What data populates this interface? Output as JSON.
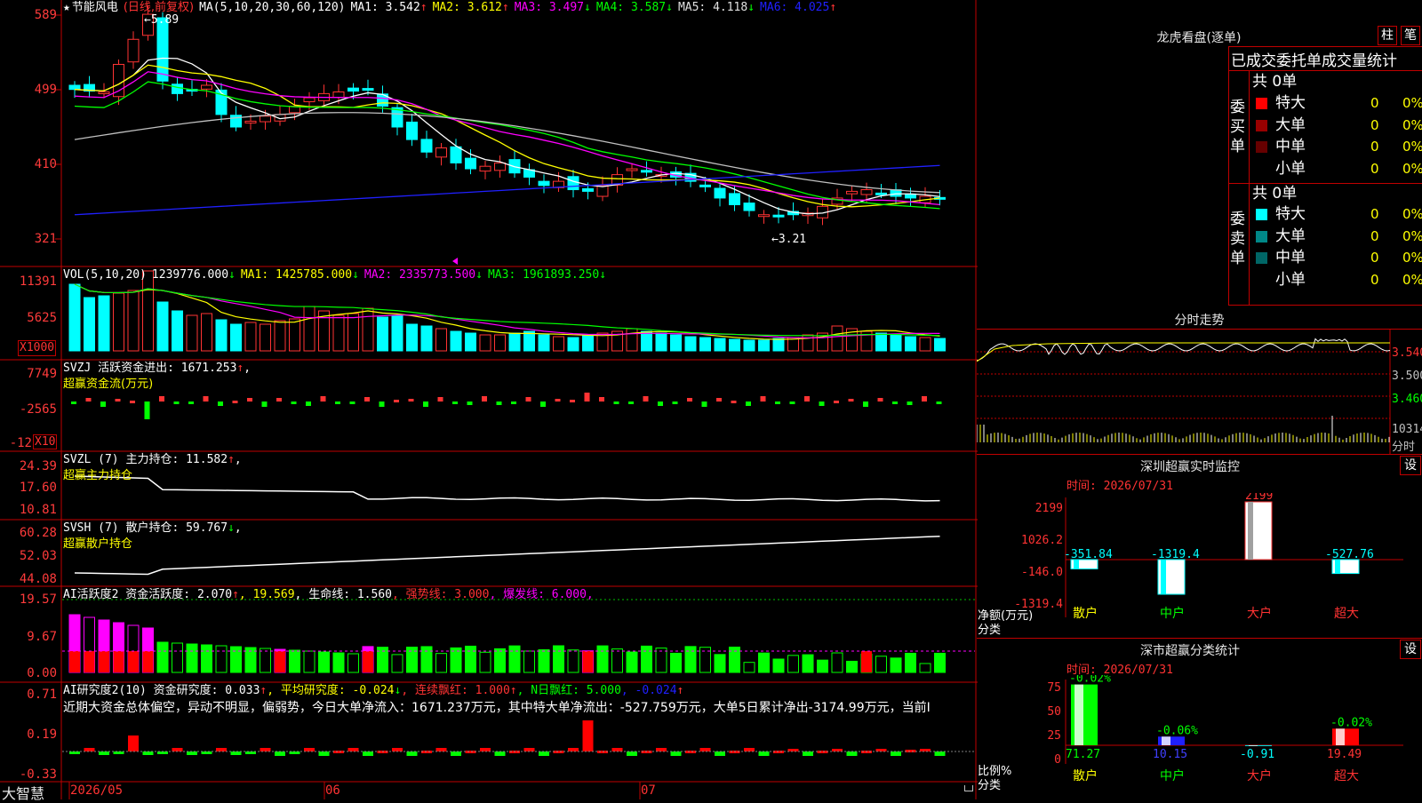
{
  "colors": {
    "up": "#ff3333",
    "down": "#00ffff",
    "grid": "#c00000",
    "bg": "#000000",
    "ma1": "#ffffff",
    "ma2": "#ffff00",
    "ma3": "#ff00ff",
    "ma4": "#00ff00",
    "ma5": "#c0c0c0",
    "ma6": "#2020ff"
  },
  "header": {
    "star": "★",
    "stock": "节能风电",
    "period": "(日线,前复权)",
    "ma_label": "MA(5,10,20,30,60,120)",
    "ma1": "MA1: 3.542",
    "ma1_arrow": "↑",
    "ma2": "MA2: 3.612",
    "ma2_arrow": "↑",
    "ma3": "MA3: 3.497",
    "ma3_arrow": "↓",
    "ma4": "MA4: 3.587",
    "ma4_arrow": "↓",
    "ma5": "MA5: 4.118",
    "ma5_arrow": "↓",
    "ma6": "MA6: 4.025",
    "ma6_arrow": "↑",
    "high_note": "5.89",
    "low_note": "←3.21"
  },
  "price_axis": [
    "589",
    "499",
    "410",
    "321"
  ],
  "vol": {
    "title": "VOL(5,10,20)",
    "v": "1239776.000",
    "v_arrow": "↓",
    "ma1": "MA1: 1425785.000",
    "ma1_arrow": "↓",
    "ma2": "MA2: 2335773.500",
    "ma2_arrow": "↓",
    "ma3": "MA3: 1961893.250",
    "ma3_arrow": "↓",
    "axis": [
      "11391",
      "5625"
    ],
    "unit": "X1000"
  },
  "svzj": {
    "title": "SVZJ  活跃资金进出: 1671.253",
    "arrow": "↑",
    "comma": ",",
    "subtitle": "超赢资金流(万元)",
    "axis": [
      "7749",
      "-2565",
      "-12"
    ],
    "unit": "X10"
  },
  "svzl": {
    "title": "SVZL (7) 主力持仓: 11.582",
    "arrow": "↑",
    "comma": ",",
    "subtitle": "超赢主力持仓",
    "axis": [
      "24.39",
      "17.60",
      "10.81"
    ]
  },
  "svsh": {
    "title": "SVSH (7) 散户持仓: 59.767",
    "arrow": "↓",
    "comma": ",",
    "subtitle": "超赢散户持仓",
    "axis": [
      "60.28",
      "52.03",
      "44.08"
    ]
  },
  "ai1": {
    "title": "AI活跃度2 资金活跃度: 2.070",
    "a1": "↑",
    "v2": ", 19.569",
    "lf": ", 生命线: 1.560",
    "strong": ", 强势线: 3.000",
    "burst": ", 爆发线: 6.000,",
    "axis": [
      "19.57",
      "9.67",
      "0.00"
    ]
  },
  "ai2": {
    "title": "AI研究度2(10) 资金研究度: 0.033",
    "a1": "↑",
    "avg": ", 平均研究度: -0.024",
    "a2": "↓",
    "streak": ", 连续飘红: 1.000",
    "a3": "↑",
    "nday": ", N日飘红: 5.000",
    "negv": ", -0.024",
    "a4": "↑",
    "summary": "近期大资金总体偏空，异动不明显，偏弱势，今日大单净流入：1671.237万元，其中特大单净流出：-527.759万元，大单5日累计净出-3174.99万元，当前I",
    "axis": [
      "0.71",
      "0.19",
      "-0.33"
    ]
  },
  "footer": {
    "brand": "大智慧",
    "dates": [
      "2026/05",
      "06",
      "07"
    ]
  },
  "orderbook": {
    "title": "龙虎看盘(逐单)",
    "btn1": "柱",
    "btn2": "笔",
    "tab": "已成交委托单成交量统计",
    "buy_label": "委买单",
    "sell_label": "委卖单",
    "buy_total": "共 0单",
    "sell_total": "共 0单",
    "buy_rows": [
      {
        "name": "特大",
        "n": "0",
        "p": "0%",
        "c": "#ff0000"
      },
      {
        "name": "大单",
        "n": "0",
        "p": "0%",
        "c": "#990000"
      },
      {
        "name": "中单",
        "n": "0",
        "p": "0%",
        "c": "#660000"
      },
      {
        "name": "小单",
        "n": "0",
        "p": "0%",
        "c": "#000000"
      }
    ],
    "sell_rows": [
      {
        "name": "特大",
        "n": "0",
        "p": "0%",
        "c": "#00ffff"
      },
      {
        "name": "大单",
        "n": "0",
        "p": "0%",
        "c": "#008888"
      },
      {
        "name": "中单",
        "n": "0",
        "p": "0%",
        "c": "#006666"
      },
      {
        "name": "小单",
        "n": "0",
        "p": "0%",
        "c": "#000000"
      }
    ]
  },
  "intraday": {
    "title": "分时走势",
    "axis": [
      "3.540",
      "3.500",
      "3.460"
    ],
    "vol_axis": "10314",
    "vol_label": "分时"
  },
  "monitor": {
    "title": "深圳超赢实时监控",
    "btn": "设",
    "time": "时间: 2026/07/31",
    "axis": [
      "2199",
      "1026.2",
      "-146.0",
      "-1319.4"
    ],
    "ylabel": "净额(万元)",
    "xlabel": "分类",
    "categories": [
      "散户",
      "中户",
      "大户",
      "超大"
    ],
    "values": [
      -351.84,
      -1319.4,
      2199,
      -527.76
    ],
    "labels": [
      "-351.84",
      "-1319.4",
      "2199",
      "-527.76"
    ]
  },
  "classify": {
    "title": "深市超赢分类统计",
    "btn": "设",
    "time": "时间: 2026/07/31",
    "axis": [
      "75",
      "50",
      "25",
      "0"
    ],
    "ylabel": "比例%",
    "xlabel": "分类",
    "categories": [
      "散户",
      "中户",
      "大户",
      "超大"
    ],
    "values": [
      71.27,
      10.15,
      -0.91,
      19.49
    ],
    "labels": [
      "71.27",
      "10.15",
      "-0.91",
      "19.49"
    ],
    "changes": [
      "-0.02%",
      "-0.06%",
      "",
      "-0.02%"
    ]
  }
}
